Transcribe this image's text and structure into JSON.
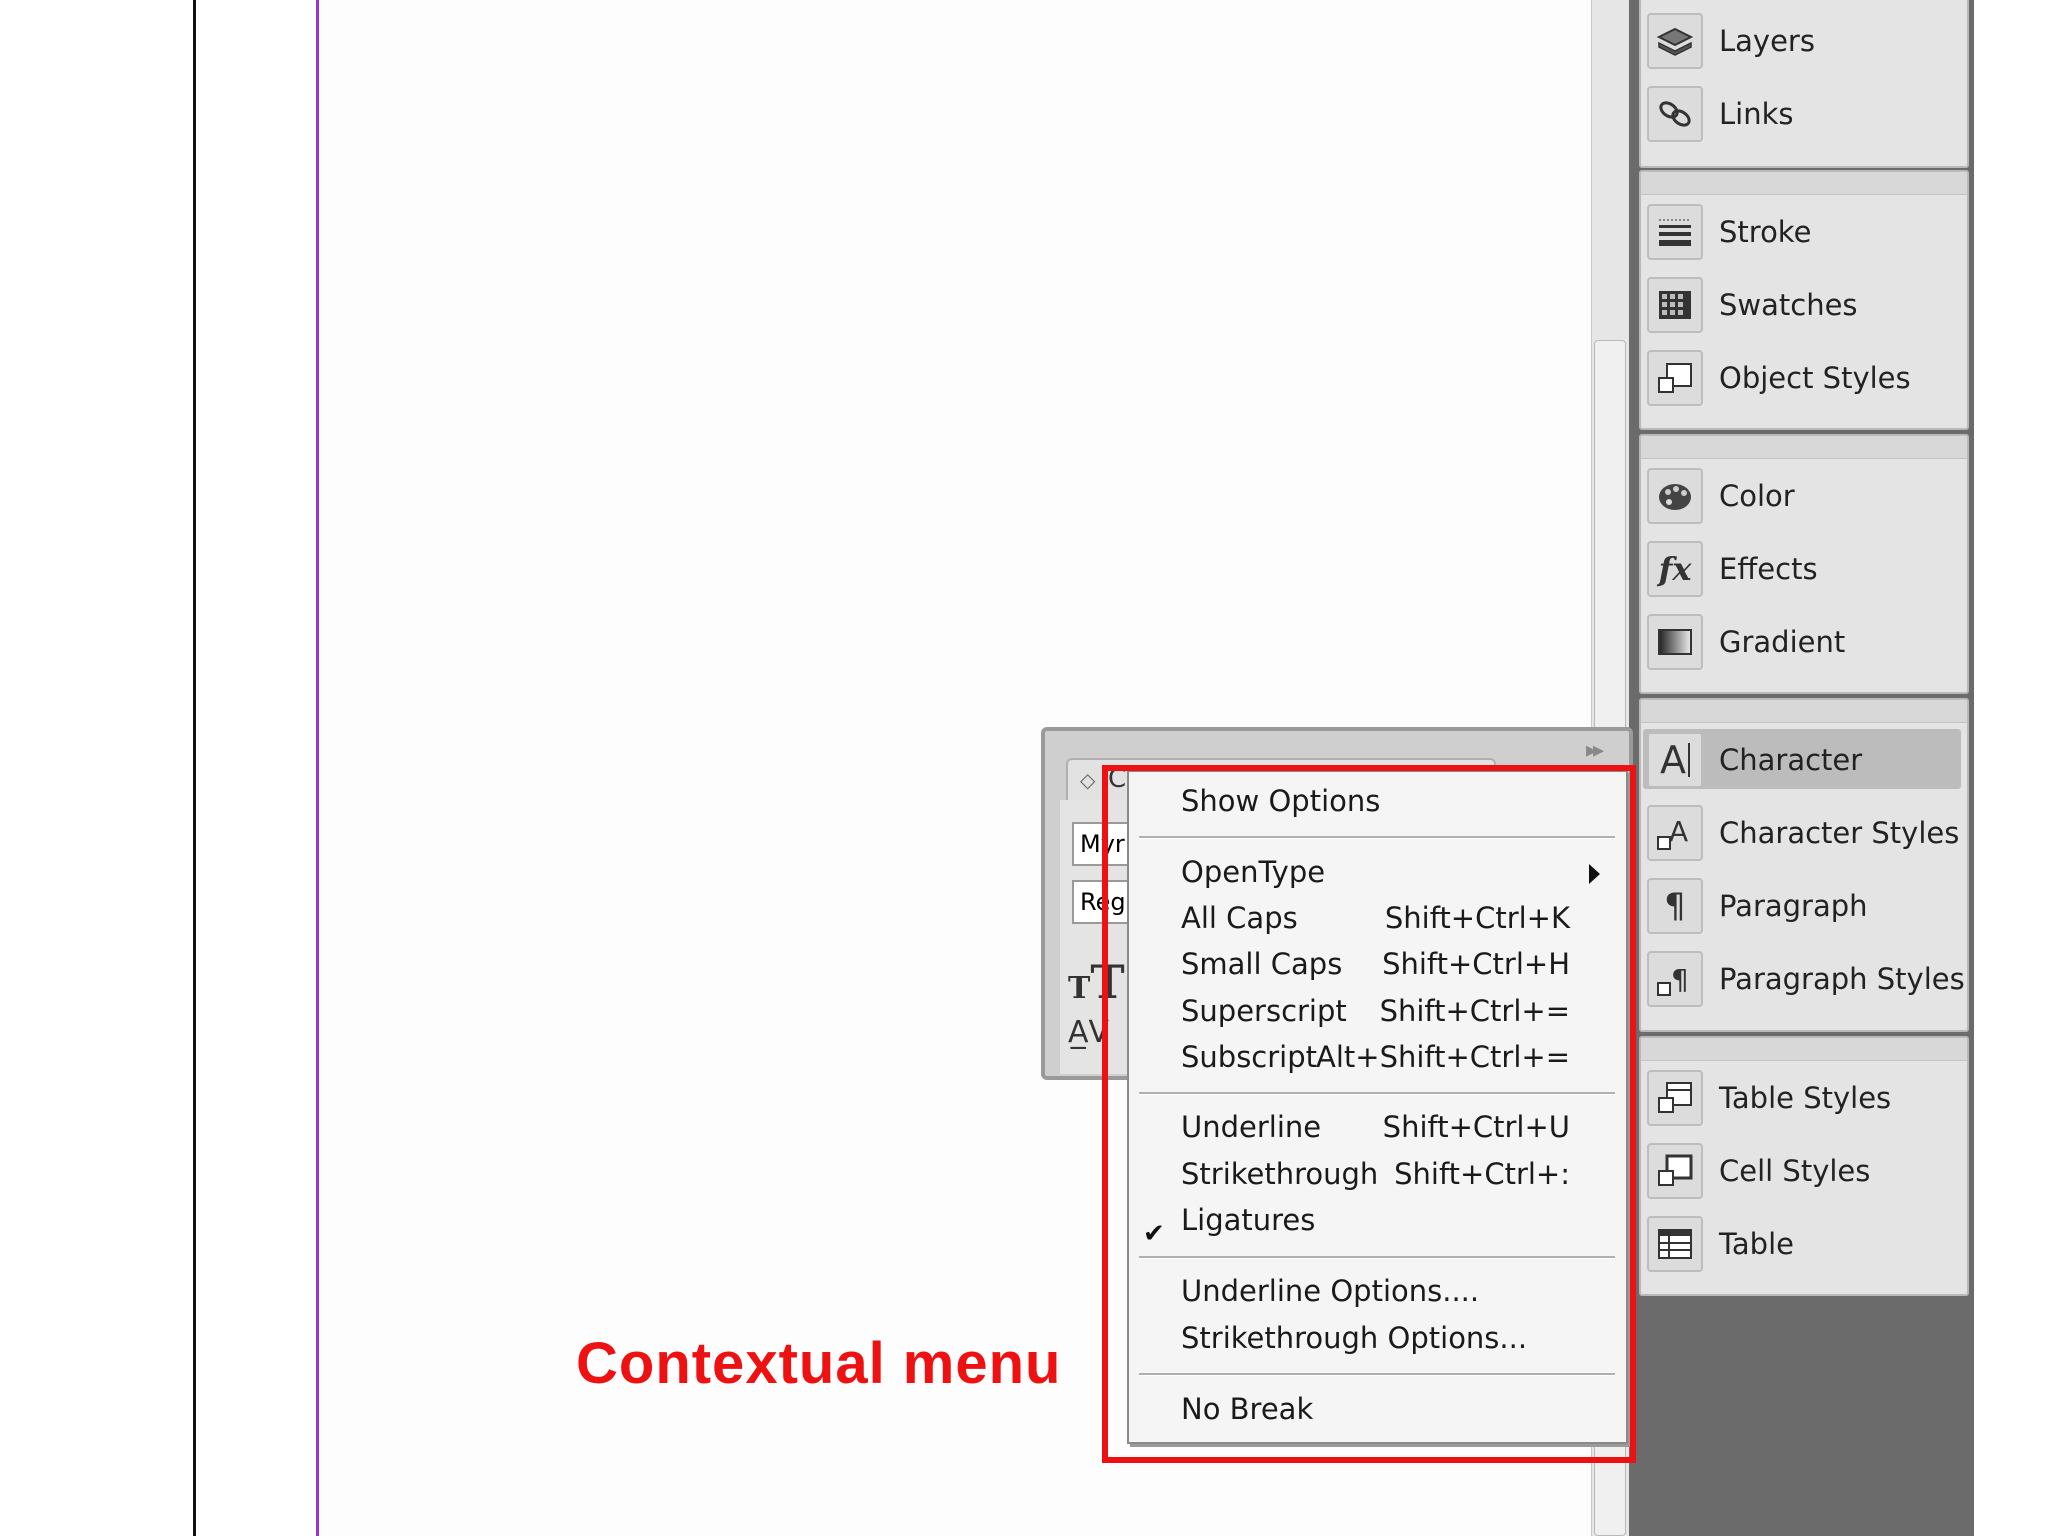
{
  "panels": {
    "group1": [
      {
        "label": "Layers",
        "icon": "layers-icon"
      },
      {
        "label": "Links",
        "icon": "links-icon"
      }
    ],
    "group2": [
      {
        "label": "Stroke",
        "icon": "stroke-icon"
      },
      {
        "label": "Swatches",
        "icon": "swatches-icon"
      },
      {
        "label": "Object Styles",
        "icon": "object-styles-icon"
      }
    ],
    "group3": [
      {
        "label": "Color",
        "icon": "color-palette-icon"
      },
      {
        "label": "Effects",
        "icon": "fx-icon"
      },
      {
        "label": "Gradient",
        "icon": "gradient-icon"
      }
    ],
    "group4": [
      {
        "label": "Character",
        "icon": "character-icon",
        "active": true
      },
      {
        "label": "Character Styles",
        "icon": "character-styles-icon"
      },
      {
        "label": "Paragraph",
        "icon": "paragraph-icon"
      },
      {
        "label": "Paragraph Styles",
        "icon": "paragraph-styles-icon"
      }
    ],
    "group5": [
      {
        "label": "Table Styles",
        "icon": "table-styles-icon"
      },
      {
        "label": "Cell Styles",
        "icon": "cell-styles-icon"
      },
      {
        "label": "Table",
        "icon": "table-icon"
      }
    ]
  },
  "character_panel": {
    "font_value": "Myri",
    "style_value": "Regu",
    "tab_label": "C"
  },
  "context_menu": {
    "show_options": "Show Options",
    "opentype": "OpenType",
    "all_caps": {
      "label": "All Caps",
      "shortcut": "Shift+Ctrl+K"
    },
    "small_caps": {
      "label": "Small Caps",
      "shortcut": "Shift+Ctrl+H"
    },
    "superscript": {
      "label": "Superscript",
      "shortcut": "Shift+Ctrl+="
    },
    "subscript": {
      "label": "Subscript",
      "shortcut": "Alt+Shift+Ctrl+="
    },
    "underline": {
      "label": "Underline",
      "shortcut": "Shift+Ctrl+U"
    },
    "strikethrough": {
      "label": "Strikethrough",
      "shortcut": "Shift+Ctrl+:"
    },
    "ligatures": {
      "label": "Ligatures",
      "checked": true
    },
    "underline_options": "Underline Options....",
    "strikethrough_options": "Strikethrough Options...",
    "no_break": "No Break"
  },
  "annotation": {
    "label": "Contextual menu",
    "color": "#ee1111"
  },
  "colors": {
    "margin_guide": "#9933cc",
    "dock_bg": "#6b6b6c"
  }
}
